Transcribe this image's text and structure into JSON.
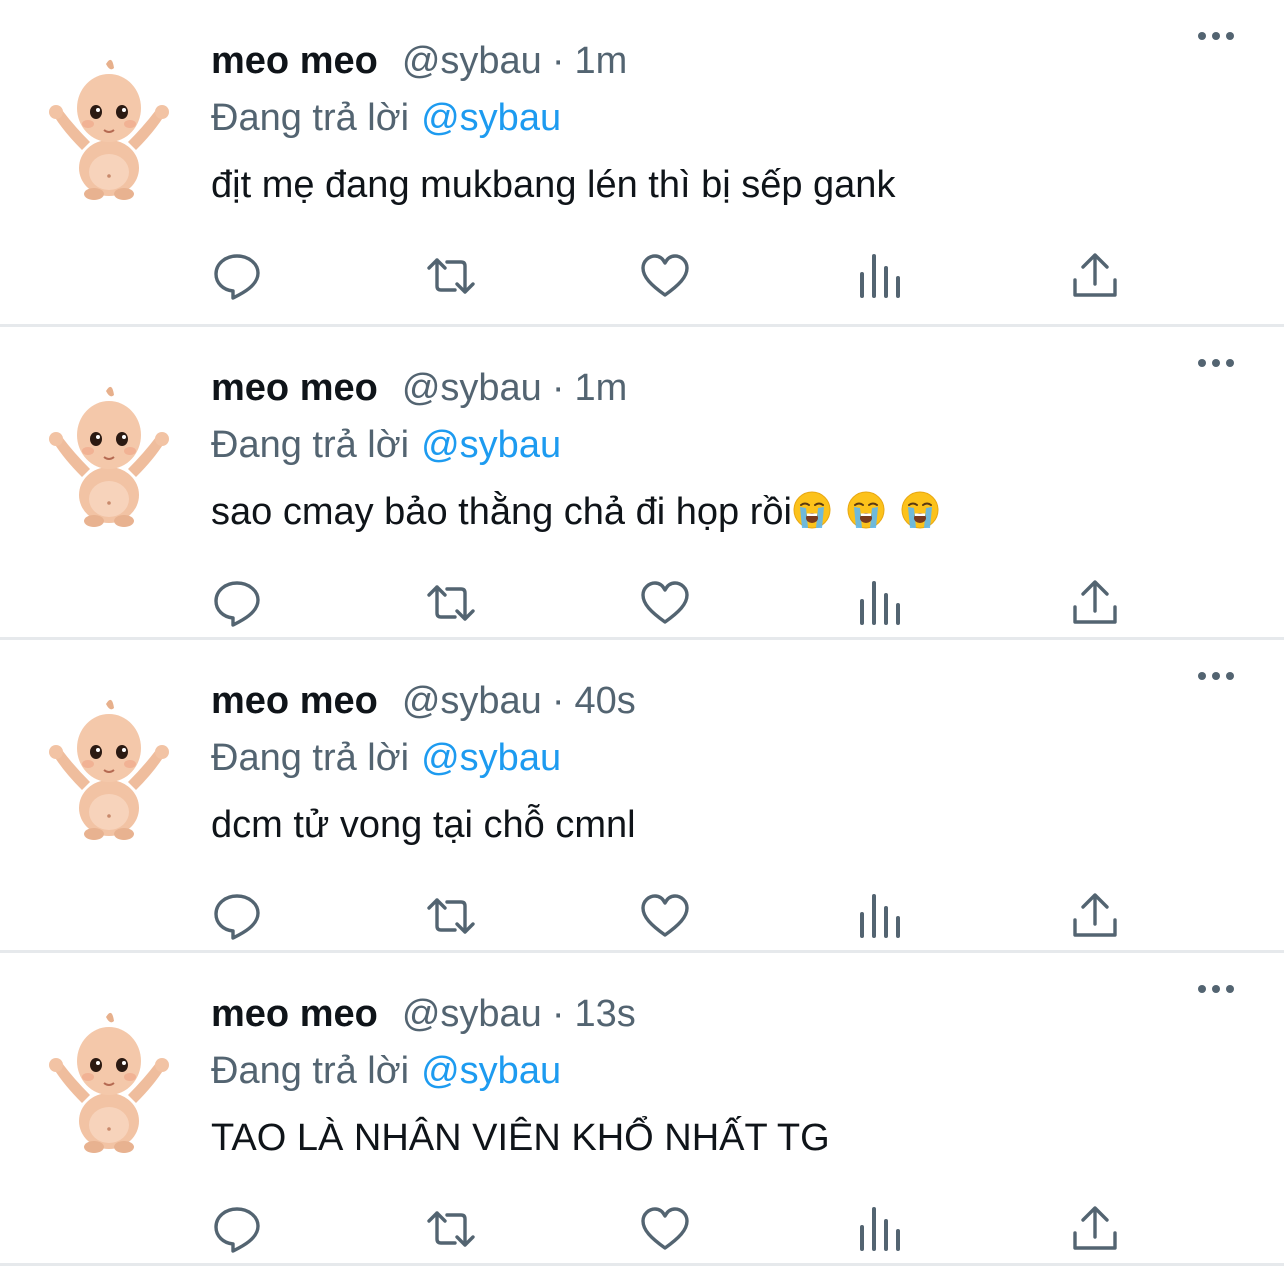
{
  "colors": {
    "text": "#0f1419",
    "secondary": "#536471",
    "link": "#1d9bf0",
    "divider": "#e6e9ec"
  },
  "reply_prefix": "Đang trả lời",
  "tweets": [
    {
      "name": "meo meo",
      "handle": "@sybau",
      "separator": "·",
      "time": "1m",
      "reply_to": "@sybau",
      "text": "địt mẹ đang mukbang lén thì bị sếp gank",
      "emoji_count": 0
    },
    {
      "name": "meo meo",
      "handle": "@sybau",
      "separator": "·",
      "time": "1m",
      "reply_to": "@sybau",
      "text": "sao cmay bảo thằng chả đi họp rồi",
      "emoji_count": 3,
      "emoji": "loudly-crying-face"
    },
    {
      "name": "meo meo",
      "handle": "@sybau",
      "separator": "·",
      "time": "40s",
      "reply_to": "@sybau",
      "text": "dcm tử vong tại chỗ cmnl",
      "emoji_count": 0
    },
    {
      "name": "meo meo",
      "handle": "@sybau",
      "separator": "·",
      "time": "13s",
      "reply_to": "@sybau",
      "text": "TAO LÀ NHÂN VIÊN KHỔ NHẤT TG",
      "emoji_count": 0
    }
  ]
}
